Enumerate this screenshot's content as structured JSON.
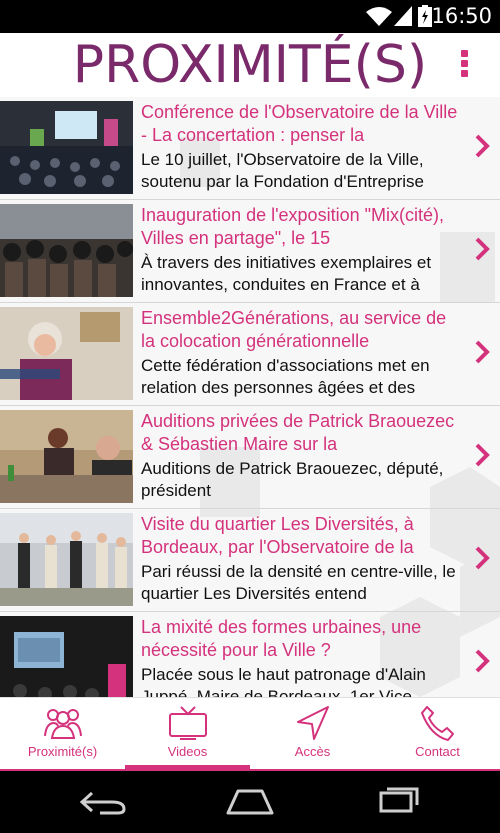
{
  "status_bar": {
    "time": "16:50"
  },
  "header": {
    "title": "PROXIMITÉ(S)"
  },
  "feed": {
    "items": [
      {
        "title": "Conférence de l'Observatoire de la Ville - La concertation : penser la",
        "description": "Le 10 juillet, l'Observatoire de la Ville, soutenu par la Fondation d'Entreprise"
      },
      {
        "title": "Inauguration de l'exposition \"Mix(cité), Villes en partage\", le 15",
        "description": "À travers des initiatives exemplaires et innovantes, conduites en France et à"
      },
      {
        "title": "Ensemble2Générations, au service de la colocation générationnelle",
        "description": "Cette fédération d'associations met en relation des personnes âgées et des"
      },
      {
        "title": "Auditions privées de Patrick Braouezec & Sébastien Maire sur la",
        "description": "Auditions de Patrick Braouezec, député, président"
      },
      {
        "title": "Visite du quartier Les Diversités, à Bordeaux, par l'Observatoire de la",
        "description": "Pari réussi de la densité en centre-ville, le quartier Les Diversités entend"
      },
      {
        "title": "La mixité des formes urbaines, une nécessité pour la Ville ?",
        "description": "Placée sous le haut patronage d'Alain Juppé, Maire de Bordeaux, 1er Vice"
      }
    ]
  },
  "tabs": [
    {
      "label": "Proximité(s)",
      "icon": "people-icon"
    },
    {
      "label": "Videos",
      "icon": "tv-icon",
      "active": true
    },
    {
      "label": "Accès",
      "icon": "navigation-arrow-icon"
    },
    {
      "label": "Contact",
      "icon": "phone-icon"
    }
  ],
  "colors": {
    "accent": "#d4327c",
    "title": "#7a2a6a"
  }
}
